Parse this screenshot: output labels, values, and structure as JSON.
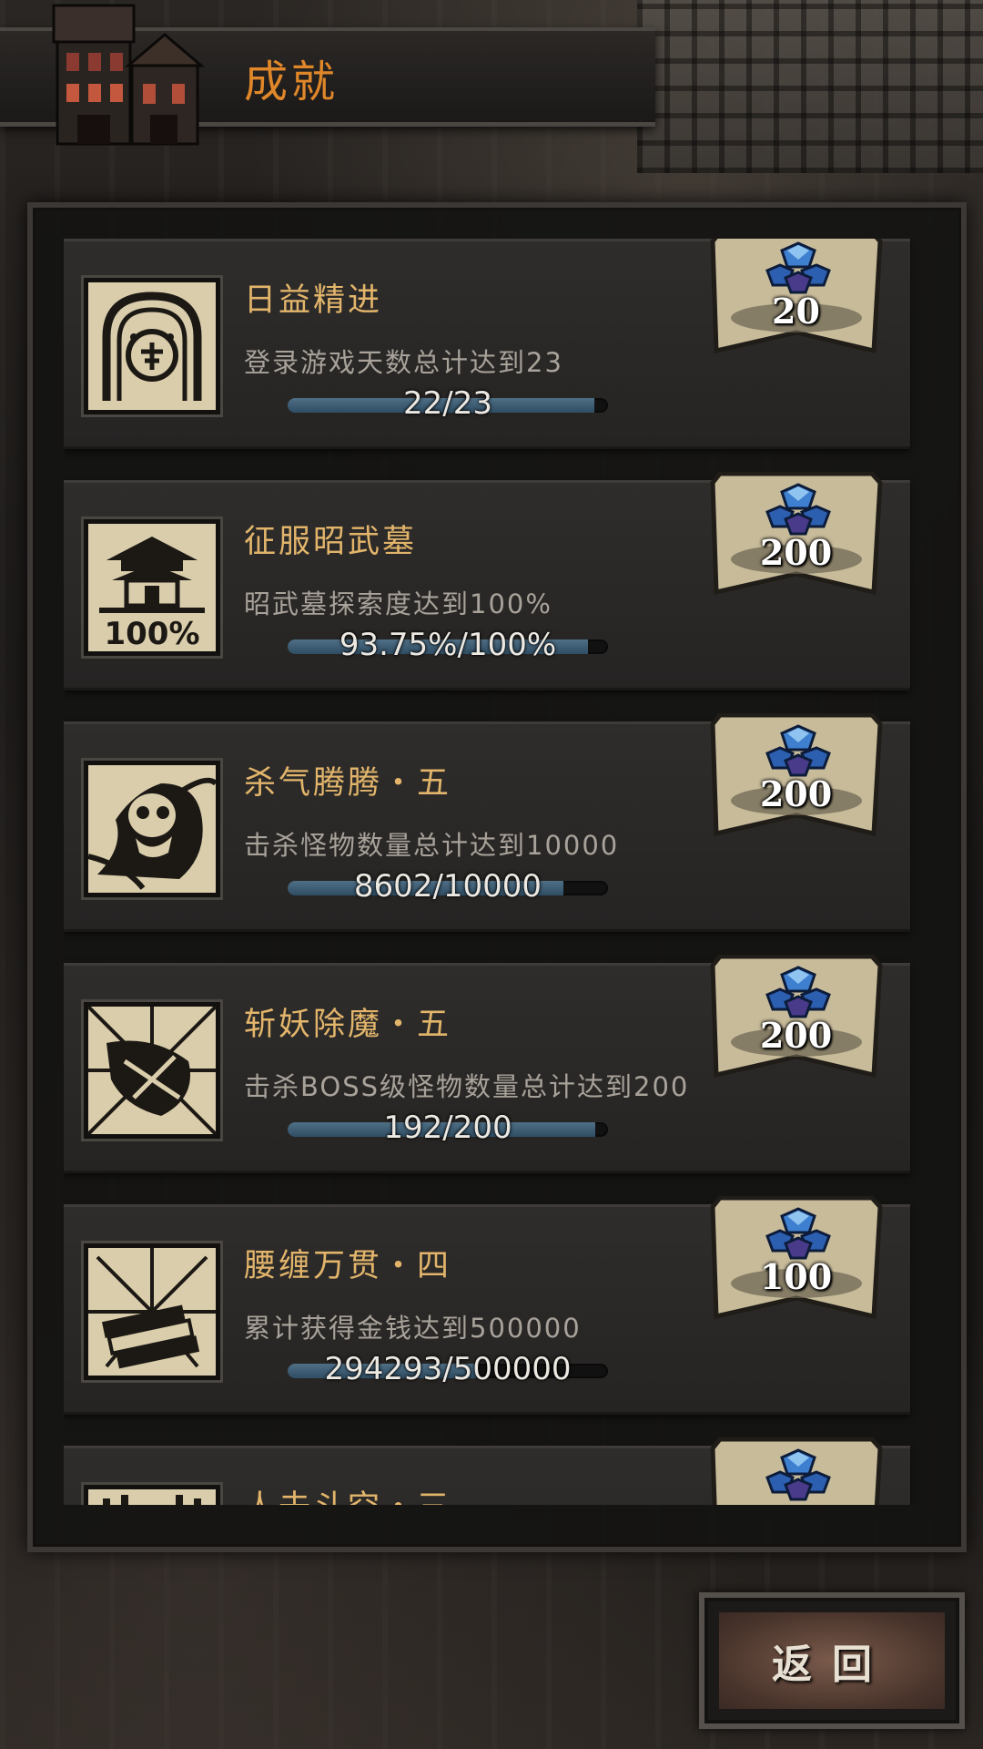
{
  "header": {
    "title": "成就"
  },
  "achievements": [
    {
      "name": "日益精进",
      "description": "登录游戏天数总计达到23",
      "progress_text": "22/23",
      "progress": 0.957,
      "reward": "20",
      "icon": "calendar-seal-icon"
    },
    {
      "name": "征服昭武墓",
      "description": "昭武墓探索度达到100%",
      "progress_text": "93.75%/100%",
      "progress": 0.9375,
      "reward": "200",
      "icon": "tomb-pagoda-icon",
      "icon_label": "100%"
    },
    {
      "name": "杀气腾腾・五",
      "description": "击杀怪物数量总计达到10000",
      "progress_text": "8602/10000",
      "progress": 0.8602,
      "reward": "200",
      "icon": "skull-monster-icon"
    },
    {
      "name": "斩妖除魔・五",
      "description": "击杀BOSS级怪物数量总计达到200",
      "progress_text": "192/200",
      "progress": 0.96,
      "reward": "200",
      "icon": "demon-slash-icon"
    },
    {
      "name": "腰缠万贯・四",
      "description": "累计获得金钱达到500000",
      "progress_text": "294293/500000",
      "progress": 0.5886,
      "reward": "100",
      "icon": "money-stack-icon"
    },
    {
      "name": "人去斗空・三",
      "description": "",
      "progress_text": "",
      "progress": 0,
      "reward": "",
      "icon": "hand-icon"
    }
  ],
  "reward_icon": "blue-gem-icon",
  "buttons": {
    "return_label": "返回"
  },
  "colors": {
    "title": "#e0872a",
    "name": "#e2b56b",
    "bar": "#3c5c73"
  }
}
